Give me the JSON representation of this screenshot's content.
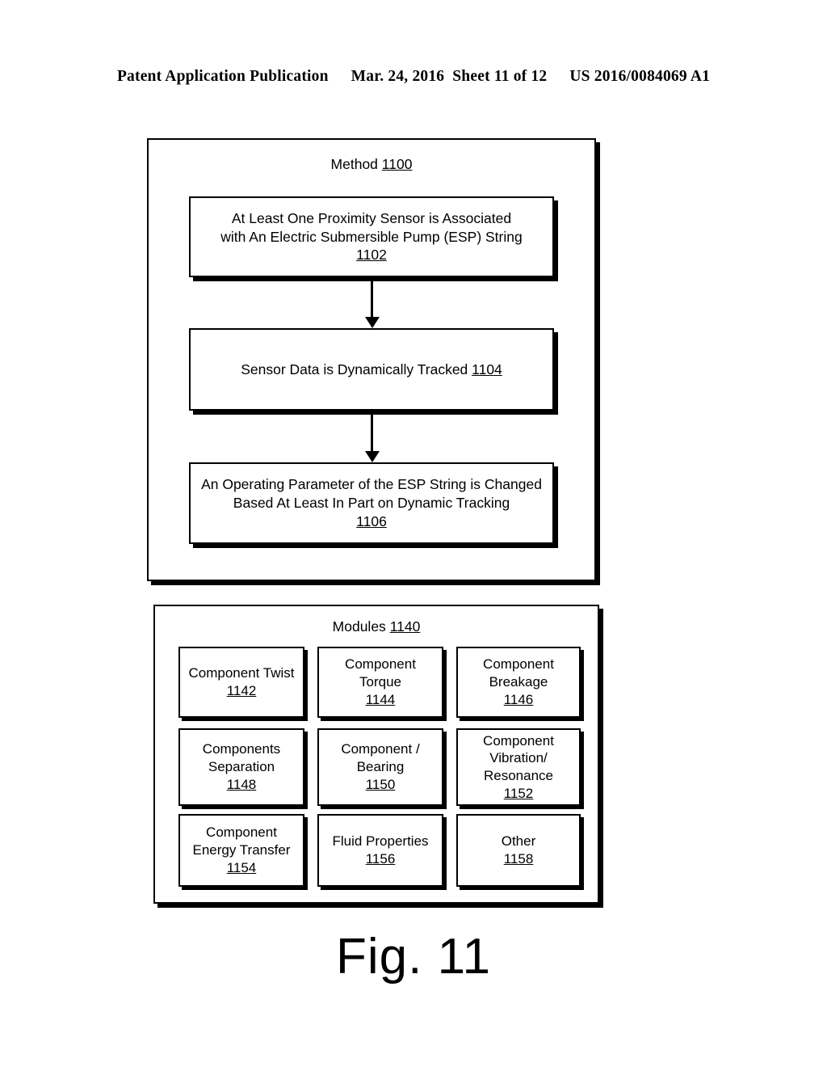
{
  "header": {
    "publication": "Patent Application Publication",
    "date": "Mar. 24, 2016",
    "sheet": "Sheet 11 of 12",
    "patent_number": "US 2016/0084069 A1"
  },
  "method": {
    "title_label": "Method",
    "title_ref": "1100",
    "steps": [
      {
        "text": "At Least One Proximity Sensor is Associated with An Electric Submersible Pump (ESP) String",
        "line1": "At Least One Proximity Sensor is Associated",
        "line2": "with An Electric Submersible Pump (ESP) String",
        "ref": "1102"
      },
      {
        "text": "Sensor Data is Dynamically Tracked",
        "line1": "Sensor Data is Dynamically Tracked",
        "ref": "1104",
        "inline_ref": true
      },
      {
        "text": "An Operating Parameter of the ESP String is Changed Based At Least In Part on Dynamic Tracking",
        "line1": "An Operating Parameter of the ESP String is Changed",
        "line2": "Based At Least In Part on Dynamic Tracking",
        "ref": "1106"
      }
    ]
  },
  "modules": {
    "title_label": "Modules",
    "title_ref": "1140",
    "items": [
      {
        "line1": "Component Twist",
        "line2": "",
        "line3": "",
        "ref": "1142"
      },
      {
        "line1": "Component",
        "line2": "Torque",
        "line3": "",
        "ref": "1144"
      },
      {
        "line1": "Component",
        "line2": "Breakage",
        "line3": "",
        "ref": "1146"
      },
      {
        "line1": "Components",
        "line2": "Separation",
        "line3": "",
        "ref": "1148"
      },
      {
        "line1": "Component /",
        "line2": "Bearing",
        "line3": "",
        "ref": "1150"
      },
      {
        "line1": "Component",
        "line2": "Vibration/",
        "line3": "Resonance",
        "ref": "1152"
      },
      {
        "line1": "Component",
        "line2": "Energy Transfer",
        "line3": "",
        "ref": "1154"
      },
      {
        "line1": "Fluid Properties",
        "line2": "",
        "line3": "",
        "ref": "1156"
      },
      {
        "line1": "Other",
        "line2": "",
        "line3": "",
        "ref": "1158"
      }
    ]
  },
  "figure": {
    "caption": "Fig. 11"
  },
  "colors": {
    "ink": "#000000",
    "page": "#ffffff"
  }
}
